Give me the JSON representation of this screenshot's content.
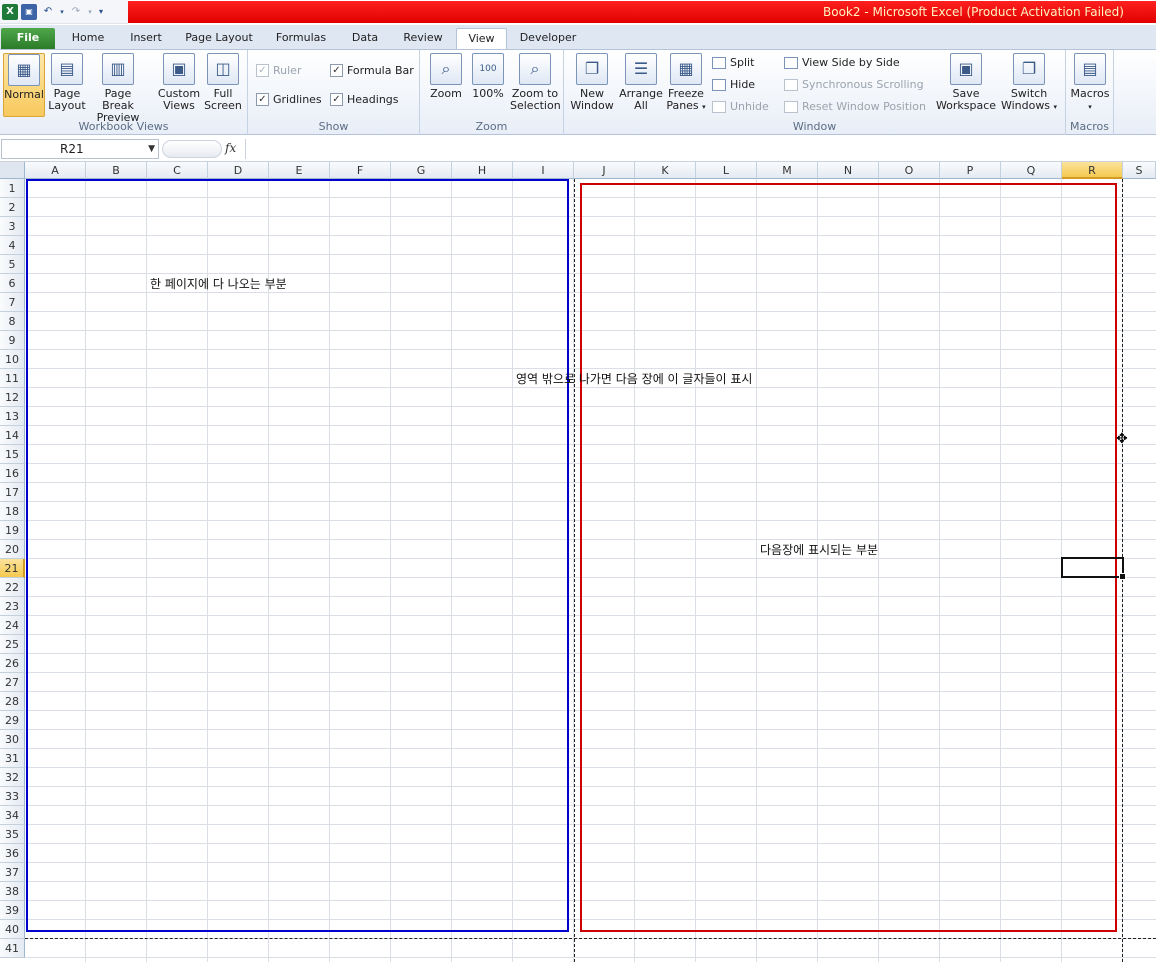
{
  "title": "Book2  -  Microsoft Excel (Product Activation Failed)",
  "qat": {
    "app_icon": "excel-icon",
    "save_icon": "save-icon",
    "undo_icon": "undo-icon",
    "redo_icon": "redo-icon",
    "customize_icon": "customize-qat-icon"
  },
  "tabs": [
    "File",
    "Home",
    "Insert",
    "Page Layout",
    "Formulas",
    "Data",
    "Review",
    "View",
    "Developer"
  ],
  "active_tab": "View",
  "ribbon": {
    "workbook_views": {
      "label": "Workbook Views",
      "normal": "Normal",
      "page_layout": [
        "Page",
        "Layout"
      ],
      "page_break_preview": [
        "Page Break",
        "Preview"
      ],
      "custom_views": [
        "Custom",
        "Views"
      ],
      "full_screen": [
        "Full",
        "Screen"
      ]
    },
    "show": {
      "label": "Show",
      "ruler": "Ruler",
      "formula_bar": "Formula Bar",
      "gridlines": "Gridlines",
      "headings": "Headings",
      "ruler_checked": true,
      "formula_bar_checked": true,
      "gridlines_checked": true,
      "headings_checked": true
    },
    "zoom": {
      "label": "Zoom",
      "zoom": "Zoom",
      "hundred": "100%",
      "zoom_to_selection": [
        "Zoom to",
        "Selection"
      ]
    },
    "window": {
      "label": "Window",
      "new_window": [
        "New",
        "Window"
      ],
      "arrange_all": [
        "Arrange",
        "All"
      ],
      "freeze_panes": [
        "Freeze",
        "Panes"
      ],
      "split": "Split",
      "hide": "Hide",
      "unhide": "Unhide",
      "view_side_by_side": "View Side by Side",
      "synchronous_scrolling": "Synchronous Scrolling",
      "reset_window_position": "Reset Window Position",
      "save_workspace": [
        "Save",
        "Workspace"
      ],
      "switch_windows": [
        "Switch",
        "Windows"
      ]
    },
    "macros": {
      "label": "Macros",
      "macros": "Macros"
    }
  },
  "formula_bar": {
    "name_box": "R21",
    "fx": "fx",
    "value": ""
  },
  "columns": [
    "A",
    "B",
    "C",
    "D",
    "E",
    "F",
    "G",
    "H",
    "I",
    "J",
    "K",
    "L",
    "M",
    "N",
    "O",
    "P",
    "Q",
    "R",
    "S"
  ],
  "selected_column": "R",
  "rows": [
    1,
    2,
    3,
    4,
    5,
    6,
    7,
    8,
    9,
    10,
    11,
    12,
    13,
    14,
    15,
    16,
    17,
    18,
    19,
    20,
    21,
    22,
    23,
    24,
    25,
    26,
    27,
    28,
    29,
    30,
    31,
    32,
    33,
    34,
    35,
    36,
    37,
    38,
    39,
    40,
    41
  ],
  "selected_row": 21,
  "cells": {
    "C6": "한 페이지에 다 나오는 부분",
    "I11": "영역 밖으로 나가면 다음 장에 이 글자들이 표시",
    "M20": "다음장에 표시되는 부분"
  },
  "colors": {
    "page1_box": "#0000cc",
    "page2_box": "#cc0000",
    "title_bar": "#e00000",
    "file_tab": "#2b7c27"
  }
}
